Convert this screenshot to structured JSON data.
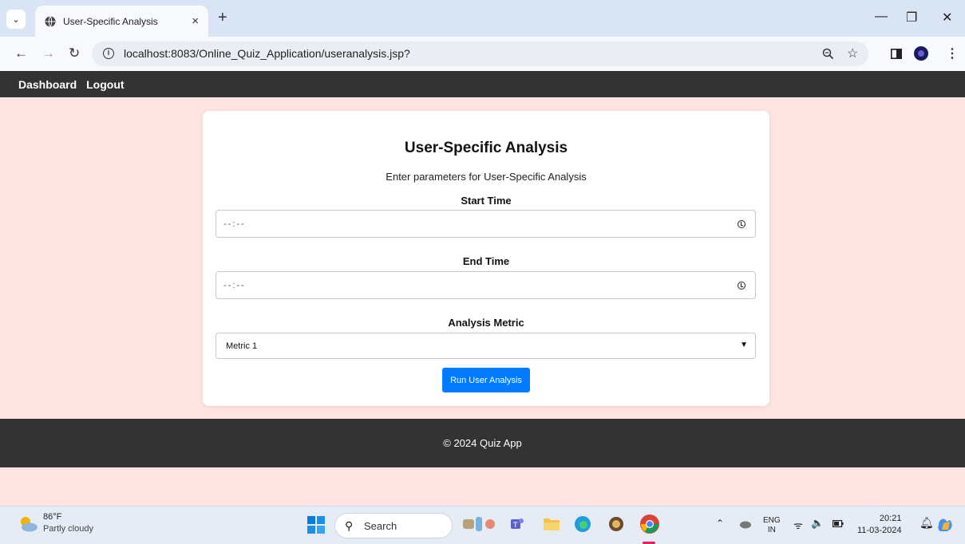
{
  "browser": {
    "tab_title": "User-Specific Analysis",
    "tab_close": "×",
    "new_tab": "+",
    "url": "localhost:8083/Online_Quiz_Application/useranalysis.jsp?",
    "window_controls": {
      "minimize": "—",
      "restore": "❐",
      "close": "✕"
    }
  },
  "nav": {
    "dashboard": "Dashboard",
    "logout": "Logout"
  },
  "card": {
    "title": "User-Specific Analysis",
    "subtitle": "Enter parameters for User-Specific Analysis",
    "start_label": "Start Time",
    "start_placeholder": "--:--",
    "end_label": "End Time",
    "end_placeholder": "--:--",
    "metric_label": "Analysis Metric",
    "metric_value": "Metric 1",
    "button": "Run User Analysis"
  },
  "footer": {
    "text": "© 2024 Quiz App"
  },
  "taskbar": {
    "weather_temp": "86°F",
    "weather_desc": "Partly cloudy",
    "search": "Search",
    "lang_top": "ENG",
    "lang_bottom": "IN",
    "time": "20:21",
    "date": "11-03-2024"
  },
  "colors": {
    "page_bg": "#ffe4e1",
    "nav_bg": "#333333",
    "button_bg": "#007bff"
  }
}
